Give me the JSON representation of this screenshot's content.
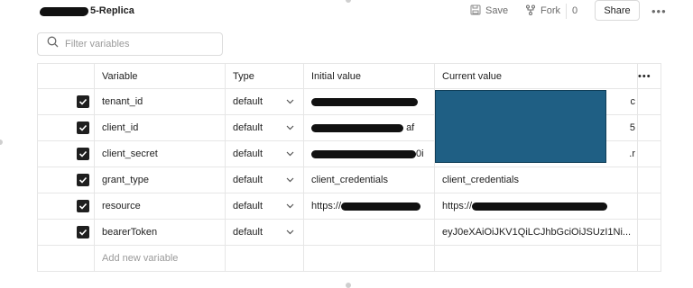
{
  "header": {
    "title_suffix": "5-Replica",
    "save_label": "Save",
    "fork_label": "Fork",
    "fork_count": "0",
    "share_label": "Share",
    "more_label": "•••"
  },
  "filter": {
    "placeholder": "Filter variables"
  },
  "table": {
    "columns": {
      "variable": "Variable",
      "type": "Type",
      "initial": "Initial value",
      "current": "Current value",
      "more": "•••"
    },
    "rows": [
      {
        "variable": "tenant_id",
        "type": "default",
        "initial_visible": "",
        "current_visible": "c"
      },
      {
        "variable": "client_id",
        "type": "default",
        "initial_visible": "af",
        "current_visible": "5"
      },
      {
        "variable": "client_secret",
        "type": "default",
        "initial_visible": "0i",
        "current_visible": ".r"
      },
      {
        "variable": "grant_type",
        "type": "default",
        "initial_visible": "client_credentials",
        "current_visible": "client_credentials"
      },
      {
        "variable": "resource",
        "type": "default",
        "initial_visible": "https://",
        "current_visible": "https://"
      },
      {
        "variable": "bearerToken",
        "type": "default",
        "initial_visible": "",
        "current_visible": "eyJ0eXAiOiJKV1QiLCJhbGciOiJSUzI1Ni..."
      }
    ],
    "add_placeholder": "Add new variable"
  },
  "colors": {
    "redaction_overlay": "#1f5f84",
    "checkbox": "#1f1f1f"
  }
}
